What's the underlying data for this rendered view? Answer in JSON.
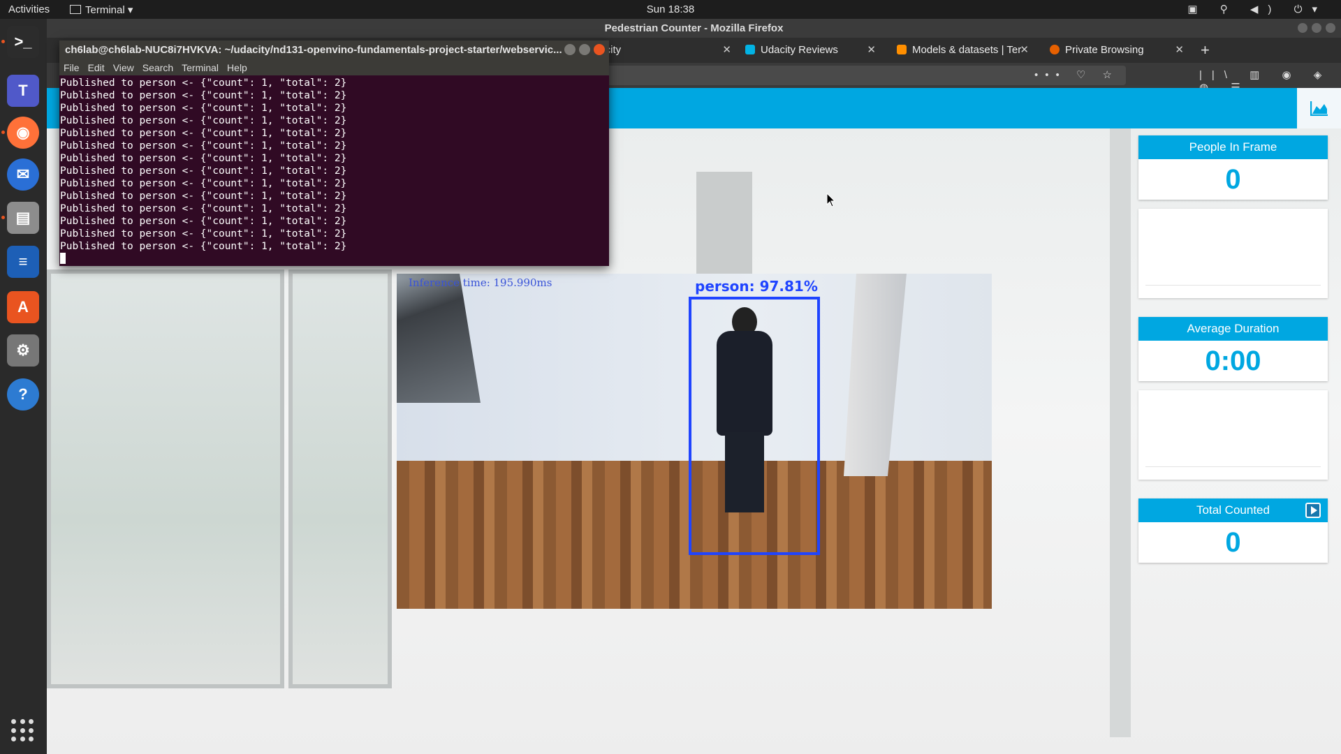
{
  "topbar": {
    "activities": "Activities",
    "app_menu": "Terminal ▾",
    "clock": "Sun 18:38"
  },
  "firefox": {
    "window_title": "Pedestrian Counter - Mozilla Firefox",
    "tabs": [
      {
        "label": "dacity",
        "icon_color": "#02b3e4"
      },
      {
        "label": "Udacity Reviews",
        "icon_color": "#02b3e4"
      },
      {
        "label": "Models & datasets | Ter",
        "icon_color": "#ff8f00"
      },
      {
        "label": "Private Browsing",
        "icon_color": "#e66000"
      }
    ],
    "tab_close": "✕",
    "new_tab": "+",
    "url_actions": "••• ♡ ☆",
    "toolbar_icons": "||\\ ▥ ◉ ◈ ◍ ☰"
  },
  "terminal": {
    "title": "ch6lab@ch6lab-NUC8i7HVKVA: ~/udacity/nd131-openvino-fundamentals-project-starter/webservic...",
    "menu": [
      "File",
      "Edit",
      "View",
      "Search",
      "Terminal",
      "Help"
    ],
    "lines": [
      "Published to person <- {\"count\": 1, \"total\": 2}",
      "Published to person <- {\"count\": 1, \"total\": 2}",
      "Published to person <- {\"count\": 1, \"total\": 2}",
      "Published to person <- {\"count\": 1, \"total\": 2}",
      "Published to person <- {\"count\": 1, \"total\": 2}",
      "Published to person <- {\"count\": 1, \"total\": 2}",
      "Published to person <- {\"count\": 1, \"total\": 2}",
      "Published to person <- {\"count\": 1, \"total\": 2}",
      "Published to person <- {\"count\": 1, \"total\": 2}",
      "Published to person <- {\"count\": 1, \"total\": 2}",
      "Published to person <- {\"count\": 1, \"total\": 2}",
      "Published to person <- {\"count\": 1, \"total\": 2}",
      "Published to person <- {\"count\": 1, \"total\": 2}",
      "Published to person <- {\"count\": 1, \"total\": 2}"
    ]
  },
  "app": {
    "accent_color": "#00a7e1",
    "video": {
      "inference_text": "Inference time: 195.990ms",
      "detection_label": "person: 97.81%"
    },
    "stats": {
      "people_in_frame": {
        "label": "People In Frame",
        "value": "0"
      },
      "average_duration": {
        "label": "Average Duration",
        "value": "0:00"
      },
      "total_counted": {
        "label": "Total Counted",
        "value": "0"
      }
    }
  },
  "dock": {
    "items": [
      {
        "name": "terminal-app-icon",
        "glyph": ">_",
        "color": "#2c2c2c"
      },
      {
        "name": "teams-app-icon",
        "glyph": "T",
        "color": "#5059c9"
      },
      {
        "name": "firefox-app-icon",
        "glyph": "◉",
        "color": "#ff7139"
      },
      {
        "name": "thunderbird-app-icon",
        "glyph": "✉",
        "color": "#2a6fd6"
      },
      {
        "name": "files-app-icon",
        "glyph": "▤",
        "color": "#8d8d8d"
      },
      {
        "name": "writer-app-icon",
        "glyph": "≡",
        "color": "#1d5fb6"
      },
      {
        "name": "software-app-icon",
        "glyph": "A",
        "color": "#e95420"
      },
      {
        "name": "settings-app-icon",
        "glyph": "⚙",
        "color": "#777"
      },
      {
        "name": "help-app-icon",
        "glyph": "?",
        "color": "#2d7bd2"
      }
    ]
  }
}
